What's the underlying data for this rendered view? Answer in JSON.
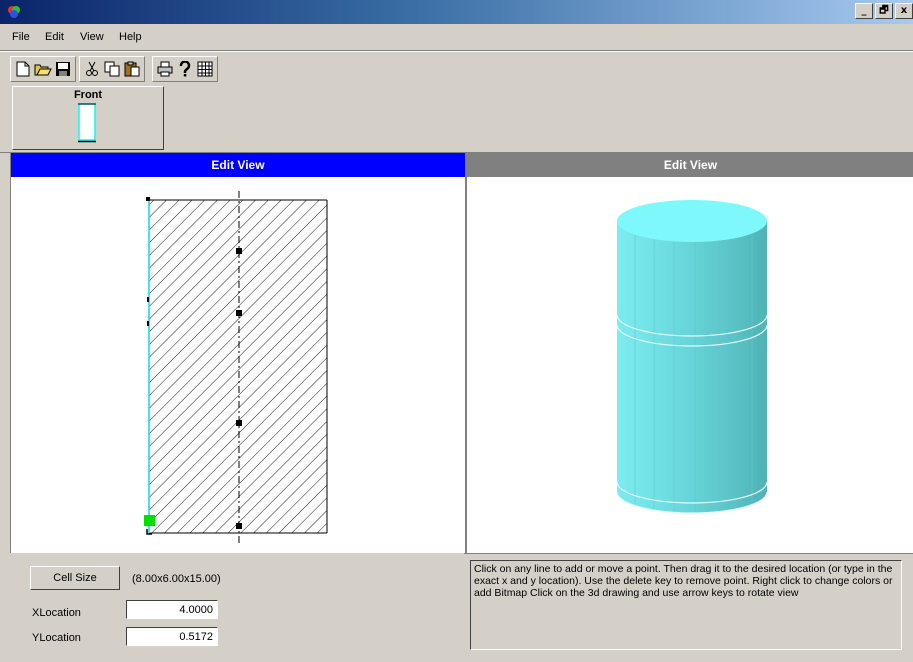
{
  "window": {
    "title": "",
    "controls": [
      "_",
      "🗗",
      "x"
    ]
  },
  "menu": [
    "File",
    "Edit",
    "View",
    "Help"
  ],
  "toolbar": {
    "icons": [
      "new-icon",
      "open-icon",
      "save-icon",
      "cut-icon",
      "copy-icon",
      "paste-icon",
      "print-icon",
      "help-icon",
      "grid-icon"
    ]
  },
  "thumbnails": [
    {
      "label": "Front",
      "color": "#00ffff"
    }
  ],
  "left_pane": {
    "title": "Edit View",
    "header_color": "#0000ff"
  },
  "right_pane": {
    "title": "Edit View",
    "header_color": "#808080",
    "cylinder_color": "#7fe6ea"
  },
  "cell_size": {
    "button_label": "Cell Size",
    "value": "(8.00x6.00x15.00)"
  },
  "fields": {
    "x_label": "XLocation",
    "x_value": "4.0000",
    "y_label": "YLocation",
    "y_value": "0.5172"
  },
  "help_text": "Click on any line to add or move a point. Then drag it to the desired location (or type in the exact x and y location). Use the delete key to remove point. Right click to change colors or add Bitmap Click on the 3d drawing and use arrow keys to rotate view"
}
